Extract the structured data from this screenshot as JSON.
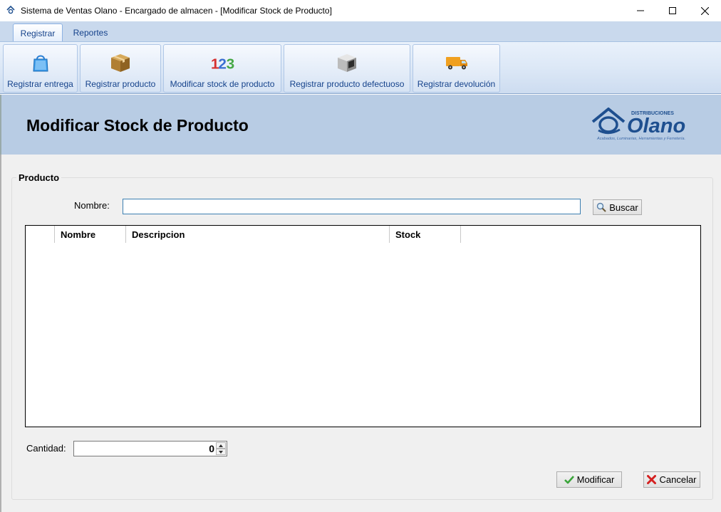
{
  "window": {
    "title": "Sistema de Ventas Olano - Encargado de almacen - [Modificar Stock de Producto]",
    "app_icon": "olano-app-icon",
    "controls": [
      "minimize-icon",
      "maximize-icon",
      "close-icon"
    ]
  },
  "ribbon": {
    "tabs": [
      {
        "label": "Registrar",
        "active": true
      },
      {
        "label": "Reportes",
        "active": false
      }
    ],
    "buttons": [
      {
        "label": "Registrar entrega",
        "icon": "shopping-bag-icon"
      },
      {
        "label": "Registrar producto",
        "icon": "box-icon"
      },
      {
        "label": "Modificar stock de producto",
        "icon": "numbers-123-icon"
      },
      {
        "label": "Registrar producto defectuoso",
        "icon": "defective-box-icon"
      },
      {
        "label": "Registrar devolución",
        "icon": "delivery-truck-icon"
      }
    ]
  },
  "header": {
    "title": "Modificar Stock de Producto",
    "logo": {
      "top_text": "DISTRIBUCIONES",
      "brand": "Olano",
      "tagline": "Acabados, Luminarias, Herramientas y Ferretería."
    }
  },
  "form": {
    "group_title": "Producto",
    "nombre_label": "Nombre:",
    "nombre_value": "",
    "buscar_label": "Buscar",
    "grid_columns": [
      "Nombre",
      "Descripcion",
      "Stock"
    ],
    "grid_rows": [],
    "cantidad_label": "Cantidad:",
    "cantidad_value": "0",
    "modificar_label": "Modificar",
    "cancelar_label": "Cancelar"
  },
  "colors": {
    "ribbon_text": "#15428b",
    "banner_bg": "#b8cce4",
    "logo_blue": "#1e4f8f",
    "ok_green": "#3aa53a",
    "cancel_red": "#d42020"
  }
}
